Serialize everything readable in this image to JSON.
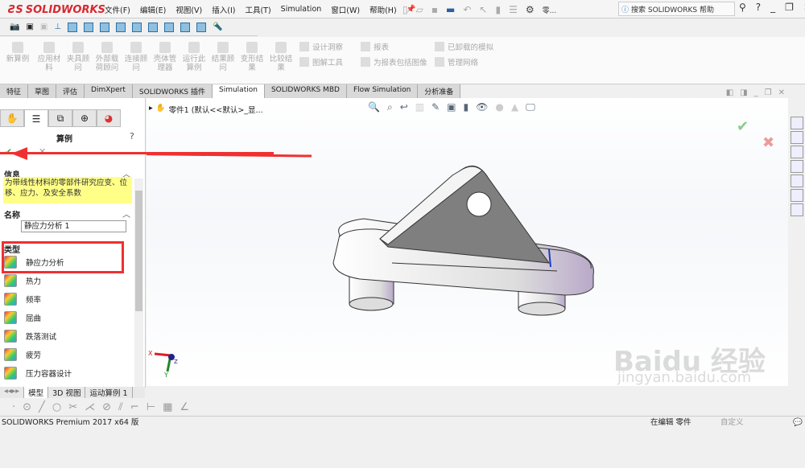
{
  "app": {
    "logo": "SOLIDWORKS"
  },
  "menu": [
    "文件(F)",
    "编辑(E)",
    "视图(V)",
    "插入(I)",
    "工具(T)",
    "Simulation",
    "窗口(W)",
    "帮助(H)"
  ],
  "quick_access": {
    "part_label": "零..."
  },
  "search": {
    "placeholder": "搜索 SOLIDWORKS 帮助"
  },
  "command_manager": {
    "large_buttons": [
      "新算例",
      "应用材料",
      "夹具顾问",
      "外部载荷顾问",
      "连接顾问",
      "壳体管理器",
      "运行此算例",
      "结果顾问",
      "变形结果",
      "比较结果"
    ],
    "small_buttons": [
      "设计洞察",
      "图解工具",
      "报表",
      "为报表包括图像",
      "已卸载的模拟",
      "管理网络"
    ]
  },
  "tabs": [
    {
      "label": "特征"
    },
    {
      "label": "草图"
    },
    {
      "label": "评估"
    },
    {
      "label": "DimXpert"
    },
    {
      "label": "SOLIDWORKS 插件"
    },
    {
      "label": "Simulation",
      "active": true
    },
    {
      "label": "SOLIDWORKS MBD"
    },
    {
      "label": "Flow Simulation"
    },
    {
      "label": "分析准备"
    }
  ],
  "panel": {
    "title": "算例",
    "info_header": "信息",
    "info_text": "为带线性材料的零部件研究应变、位移、应力、及安全系数",
    "name_header": "名称",
    "name_value": "静应力分析 1",
    "type_header": "类型",
    "types": [
      "静应力分析",
      "热力",
      "频率",
      "屈曲",
      "跌落测试",
      "疲劳",
      "压力容器设计"
    ]
  },
  "tree": {
    "root": "零件1 (默认<<默认>_显..."
  },
  "triad": {
    "x": "X",
    "y": "Y",
    "z": "Z"
  },
  "bottom_tabs": [
    "模型",
    "3D 视图",
    "运动算例 1"
  ],
  "status": {
    "product": "SOLIDWORKS Premium 2017 x64 版",
    "mode": "在编辑 零件",
    "custom": "自定义"
  },
  "watermark": {
    "brand": "Baidu 经验",
    "url": "jingyan.baidu.com"
  },
  "colors": {
    "accent": "#d8282f",
    "annotation": "#f03030",
    "info_bg": "#ffff88"
  }
}
